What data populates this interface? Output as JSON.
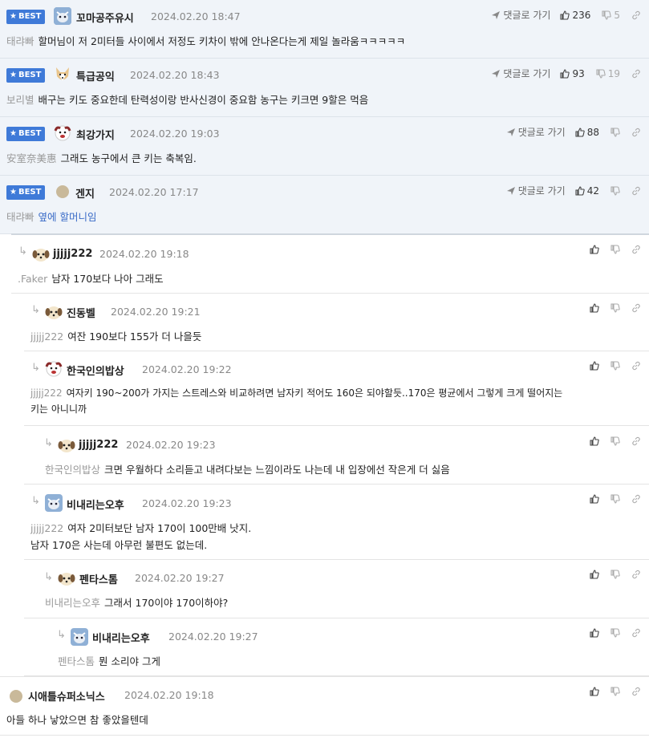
{
  "best_comments": [
    {
      "badge": "BEST",
      "nick": "꼬마공주유시",
      "date": "2024.02.20 18:47",
      "reply_to": "태랴빠",
      "text": "할머님이 저 2미터들 사이에서 저정도 키차이 밖에 안나온다는게 제일 놀라움ㅋㅋㅋㅋㅋ",
      "reply_label": "댓글로 가기",
      "up": "236",
      "down": "5"
    },
    {
      "badge": "BEST",
      "nick": "특급공익",
      "date": "2024.02.20 18:43",
      "reply_to": "보리별",
      "text": "배구는 키도 중요한데 탄력성이랑 반사신경이 중요함 농구는 키크면 9할은 먹음",
      "reply_label": "댓글로 가기",
      "up": "93",
      "down": "19"
    },
    {
      "badge": "BEST",
      "nick": "최강가지",
      "date": "2024.02.20 19:03",
      "reply_to": "安室奈美惠",
      "text": "그래도 농구에서 큰 키는 축복임.",
      "reply_label": "댓글로 가기",
      "up": "88",
      "down": ""
    },
    {
      "badge": "BEST",
      "nick": "겐지",
      "date": "2024.02.20 17:17",
      "reply_to": "태랴빠",
      "text": "옆에 할머니임",
      "reply_label": "댓글로 가기",
      "up": "42",
      "down": ""
    }
  ],
  "comments": [
    {
      "nick": "jjjjj222",
      "date": "2024.02.20 19:18",
      "reply_to": ".Faker",
      "lines": [
        "남자 170보다 나아 그래도"
      ]
    },
    {
      "nick": "진동벨",
      "date": "2024.02.20 19:21",
      "reply_to": "jjjjj222",
      "lines": [
        "여잔 190보다 155가 더 나을듯"
      ]
    },
    {
      "nick": "한국인의밥상",
      "date": "2024.02.20 19:22",
      "reply_to": "jjjjj222",
      "lines": [
        "여자키 190~200가 가지는 스트레스와 비교하려면 남자키 적어도 160은 되야할듯..170은 평균에서 그렇게 크게 떨어지는",
        "키는 아니니까"
      ]
    },
    {
      "nick": "jjjjj222",
      "date": "2024.02.20 19:23",
      "reply_to": "한국인의밥상",
      "lines": [
        "크면 우월하다 소리듣고 내려다보는 느낌이라도 나는데 내 입장에선 작은게 더 싫음"
      ]
    },
    {
      "nick": "비내리는오후",
      "date": "2024.02.20 19:23",
      "reply_to": "jjjjj222",
      "lines": [
        "여자 2미터보단 남자 170이 100만배 낫지.",
        "남자 170은 사는데 아무런 불편도 없는데."
      ]
    },
    {
      "nick": "펜타스톰",
      "date": "2024.02.20 19:27",
      "reply_to": "비내리는오후",
      "lines": [
        "그래서 170이야 170이하야?"
      ]
    },
    {
      "nick": "비내리는오후",
      "date": "2024.02.20 19:27",
      "reply_to": "펜타스톰",
      "lines": [
        "뭔 소리야 그게"
      ]
    },
    {
      "nick": "시애틀슈퍼소닉스",
      "date": "2024.02.20 19:18",
      "reply_to": "",
      "lines": [
        "아들 하나 낳았으면 참 좋았을텐데"
      ]
    }
  ],
  "colors": {
    "best_bg": "#f0f4f9",
    "badge": "#3f7ad8",
    "link_blue": "#3a6bc7"
  },
  "icons": {
    "like": "thumbs-up-icon",
    "dislike": "thumbs-down-icon",
    "share": "link-icon",
    "reply": "send-icon"
  }
}
